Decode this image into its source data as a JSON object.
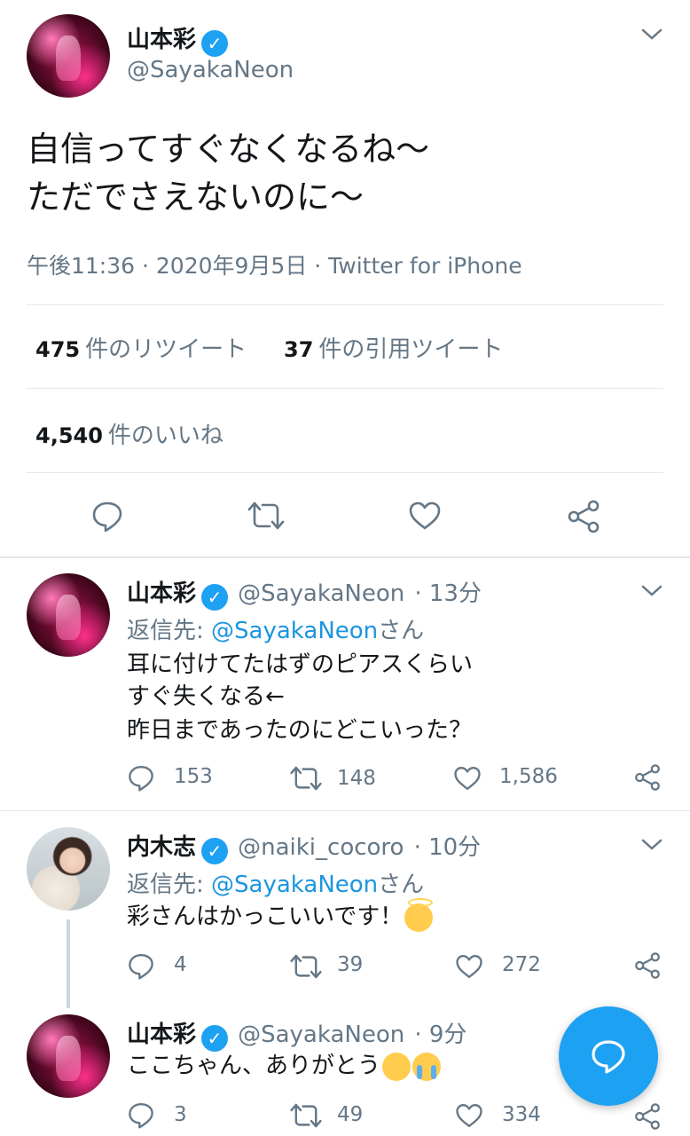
{
  "main_tweet": {
    "name": "山本彩",
    "handle": "@SayakaNeon",
    "text_line1": "自信ってすぐなくなるね〜",
    "text_line2": "ただでさえないのに〜",
    "meta": "午後11:36 · 2020年9月5日 · Twitter for iPhone",
    "retweets_count": "475",
    "retweets_label": "件のリツイート",
    "quotes_count": "37",
    "quotes_label": "件の引用ツイート",
    "likes_count": "4,540",
    "likes_label": "件のいいね"
  },
  "replies": [
    {
      "name": "山本彩",
      "handle": "@SayakaNeon",
      "time": "· 13分",
      "reply_prefix": "返信先: ",
      "reply_to": "@SayakaNeon",
      "reply_suffix": "さん",
      "line1": "耳に付けてたはずのピアスくらい",
      "line2": "すぐ失くなる←",
      "line3": "昨日まであったのにどこいった？",
      "replies": "153",
      "retweets": "148",
      "likes": "1,586"
    },
    {
      "name": "内木志",
      "handle": "@naiki_cocoro",
      "time": "· 10分",
      "reply_prefix": "返信先: ",
      "reply_to": "@SayakaNeon",
      "reply_suffix": "さん",
      "line1": "彩さんはかっこいいです！",
      "emoji1": "smiling-face-with-halo",
      "replies": "4",
      "retweets": "39",
      "likes": "272"
    },
    {
      "name": "山本彩",
      "handle": "@SayakaNeon",
      "time": "· 9分",
      "line1": "ここちゃん、ありがとう",
      "emoji1": "face-with-tears-of-joy",
      "emoji2": "loudly-crying-face",
      "replies": "3",
      "retweets": "49",
      "likes": "334"
    }
  ],
  "colors": {
    "accent": "#1da1f2",
    "link": "#1b95e0",
    "secondary_text": "#657786",
    "divider": "#e1e8ed"
  },
  "icons": [
    "verified-icon",
    "chevron-down-icon",
    "reply-icon",
    "retweet-icon",
    "like-icon",
    "share-icon",
    "compose-reply-icon"
  ]
}
